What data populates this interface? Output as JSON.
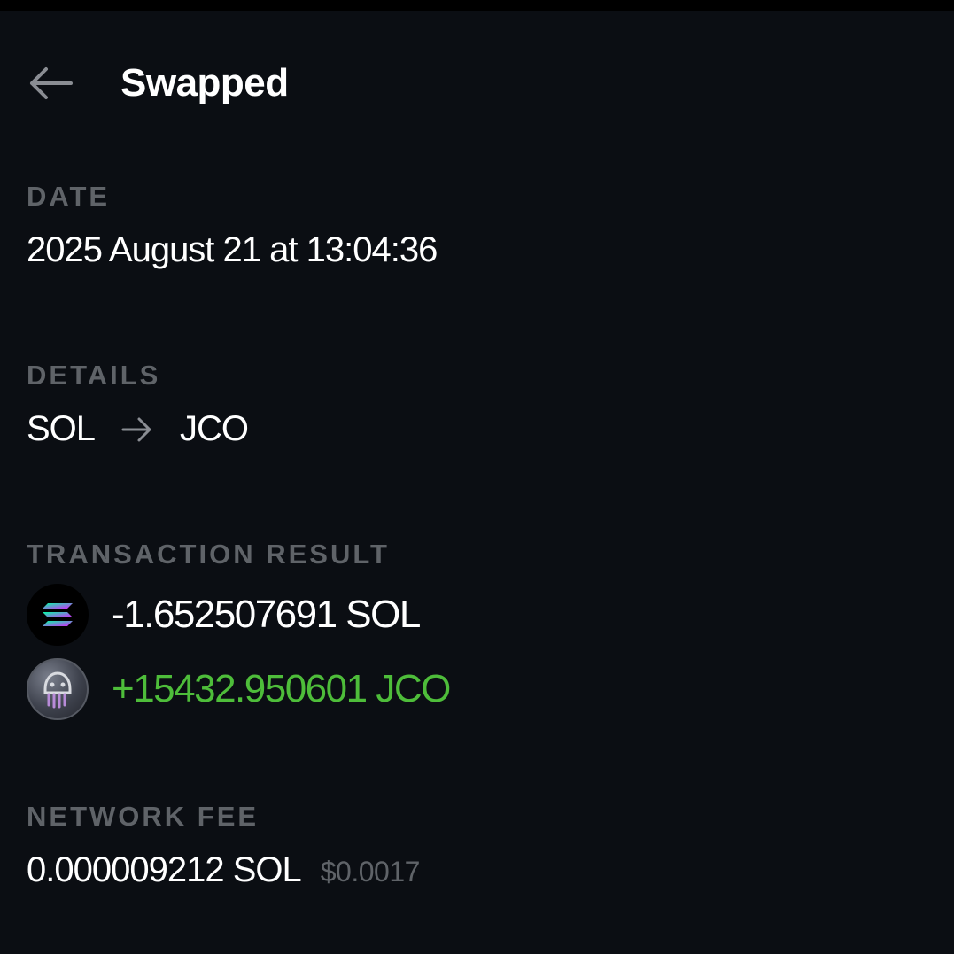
{
  "header": {
    "title": "Swapped",
    "back_icon": "arrow-left-icon"
  },
  "date": {
    "label": "DATE",
    "value": "2025 August 21 at 13:04:36"
  },
  "details": {
    "label": "DETAILS",
    "from_token": "SOL",
    "to_token": "JCO",
    "arrow_icon": "arrow-right-icon"
  },
  "transaction_result": {
    "label": "TRANSACTION RESULT",
    "items": [
      {
        "icon": "solana-token-icon",
        "amount": "-1.652507691 SOL",
        "color": "#ffffff"
      },
      {
        "icon": "jco-token-icon",
        "amount": "+15432.950601 JCO",
        "color": "#4ebd3a"
      }
    ]
  },
  "network_fee": {
    "label": "NETWORK FEE",
    "amount": "0.000009212 SOL",
    "usd": "$0.0017"
  },
  "colors": {
    "background": "#0b0e13",
    "label_gray": "#5f6368",
    "positive_green": "#4ebd3a"
  }
}
